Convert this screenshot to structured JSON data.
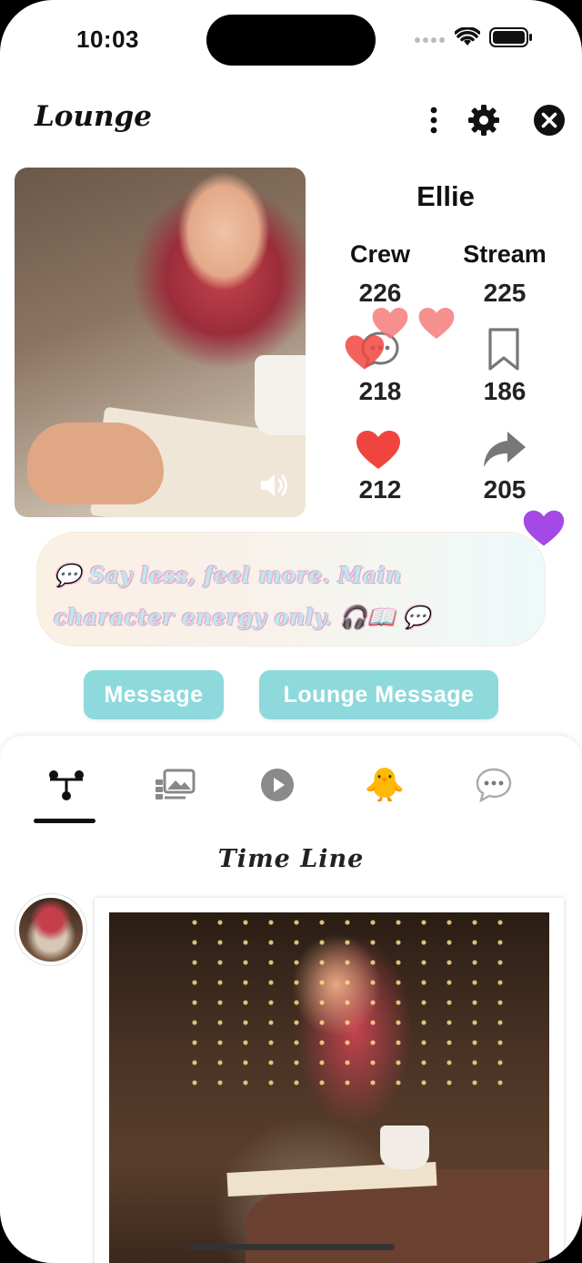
{
  "status_bar": {
    "time": "10:03"
  },
  "header": {
    "brand": "Lounge"
  },
  "profile": {
    "name": "Ellie",
    "stats": {
      "crew_label": "Crew",
      "crew_value": "226",
      "stream_label": "Stream",
      "stream_value": "225",
      "comments_value": "218",
      "bookmarks_value": "186",
      "likes_value": "212",
      "shares_value": "205"
    },
    "bio": "💬 Say less, feel more. Main character energy only. 🎧📖 💬"
  },
  "actions": {
    "message_label": "Message",
    "lounge_message_label": "Lounge Message"
  },
  "tabs": [
    {
      "icon": "timeline-icon",
      "active": true
    },
    {
      "icon": "gallery-icon"
    },
    {
      "icon": "play-icon"
    },
    {
      "icon": "chick-icon",
      "glyph": "🐥"
    },
    {
      "icon": "chat-bubble-icon"
    }
  ],
  "timeline": {
    "title": "Time Line"
  },
  "colors": {
    "accent": "#8ed9dc",
    "heart": "#f0453f",
    "bio_text": "#bfe7ee",
    "bio_outline": "#e8a5c9"
  }
}
